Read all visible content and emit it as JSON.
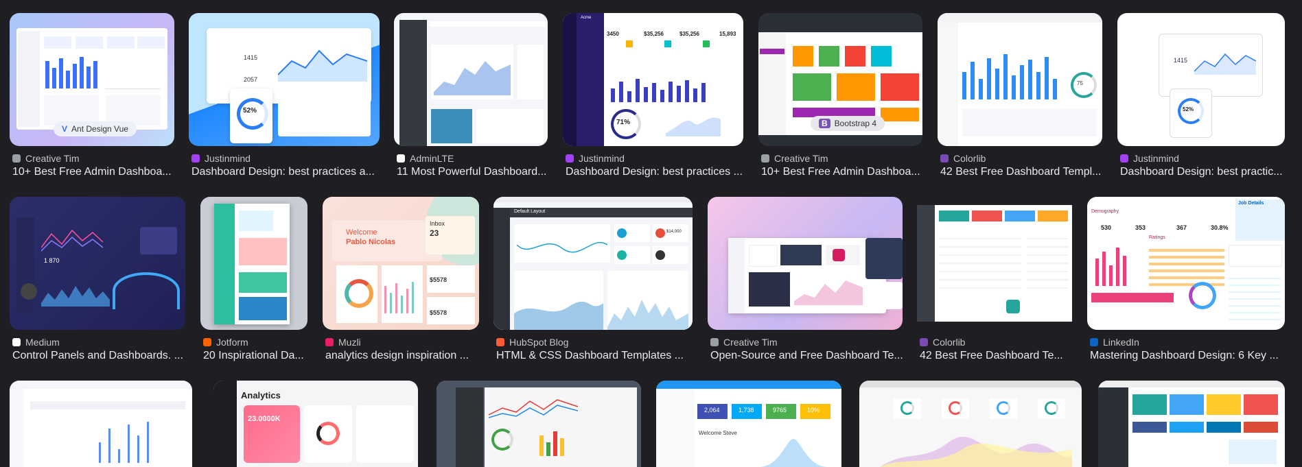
{
  "results": [
    {
      "source": "Creative Tim",
      "title": "10+ Best Free Admin Dashboa...",
      "fav": "#9aa0a6",
      "badge": "Ant Design Vue"
    },
    {
      "source": "Justinmind",
      "title": "Dashboard Design: best practices a...",
      "fav": "#a142f4",
      "badge_value": "52%",
      "stat_a": "1415",
      "stat_b": "2057"
    },
    {
      "source": "AdminLTE",
      "title": "11 Most Powerful Dashboard...",
      "fav": "#ffffff"
    },
    {
      "source": "Justinmind",
      "title": "Dashboard Design: best practices ...",
      "fav": "#a142f4",
      "stats": [
        "3450",
        "$35,256",
        "$35,256",
        "15,893"
      ],
      "ring": "71%",
      "brand": "Acme"
    },
    {
      "source": "Creative Tim",
      "title": "10+ Best Free Admin Dashboa...",
      "fav": "#9aa0a6",
      "badge": "Bootstrap 4"
    },
    {
      "source": "Colorlib",
      "title": "42 Best Free Dashboard Templ...",
      "fav": "#7b4bb5",
      "ring": "75"
    },
    {
      "source": "Justinmind",
      "title": "Dashboard Design: best practic...",
      "fav": "#a142f4",
      "badge_value": "52%",
      "stat_a": "1415"
    },
    {
      "source": "Medium",
      "title": "Control Panels and Dashboards. ...",
      "fav": "#ffffff",
      "stat": "1 870"
    },
    {
      "source": "Jotform",
      "title": "20 Inspirational Da...",
      "fav": "#ff6100"
    },
    {
      "source": "Muzli",
      "title": "analytics design inspiration ...",
      "fav": "#e91e63",
      "welcome": "Welcome",
      "name": "Pablo Nicolas",
      "inbox": "Inbox",
      "inbox_count": "23",
      "sales": "$5578",
      "sales2": "$5578"
    },
    {
      "source": "HubSpot Blog",
      "title": "HTML & CSS Dashboard Templates ...",
      "fav": "#ff5c35",
      "header": "Default Layout",
      "value": "$14,000"
    },
    {
      "source": "Creative Tim",
      "title": "Open-Source and Free Dashboard Te...",
      "fav": "#9aa0a6"
    },
    {
      "source": "Colorlib",
      "title": "42 Best Free Dashboard Te...",
      "fav": "#7b4bb5"
    },
    {
      "source": "LinkedIn",
      "title": "Mastering Dashboard Design: 6 Key ...",
      "fav": "#0a66c2",
      "labels": [
        "Job Details",
        "Demography",
        "Ratings",
        "30.8%",
        "530",
        "353",
        "367"
      ]
    },
    {
      "analytics": "Analytics",
      "value": "23.0000K"
    },
    {},
    {
      "stats": [
        "2,064",
        "1,738",
        "9765",
        "10%"
      ],
      "welcome": "Welcome Steve"
    },
    {},
    {}
  ]
}
